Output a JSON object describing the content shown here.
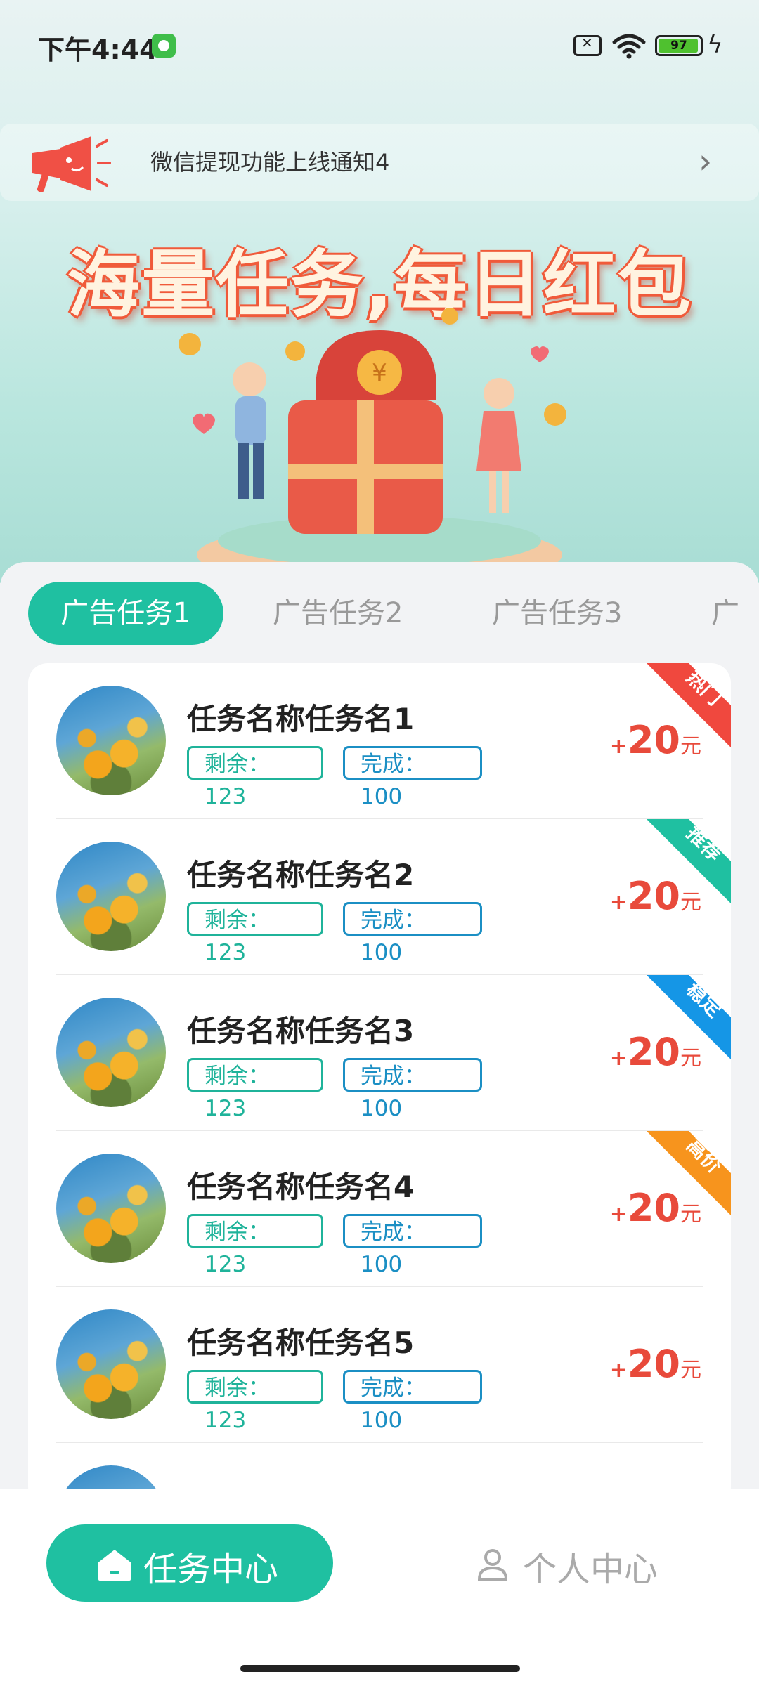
{
  "status_bar": {
    "time": "下午4:44",
    "battery": "97",
    "battery_level": 0.97
  },
  "notice": {
    "text": "微信提现功能上线通知4"
  },
  "banner": {
    "title": "海量任务,每日红包"
  },
  "tabs": [
    {
      "label": "广告任务1"
    },
    {
      "label": "广告任务2"
    },
    {
      "label": "广告任务3"
    },
    {
      "label": "广"
    }
  ],
  "tasks": [
    {
      "name": "任务名称任务名1",
      "remain": "剩余：123",
      "done": "完成：100",
      "reward_prefix": "+",
      "reward": "20",
      "reward_unit": "元",
      "badge": "热门",
      "badge_color": "#f0483e"
    },
    {
      "name": "任务名称任务名2",
      "remain": "剩余：123",
      "done": "完成：100",
      "reward_prefix": "+",
      "reward": "20",
      "reward_unit": "元",
      "badge": "推荐",
      "badge_color": "#1fc0a1"
    },
    {
      "name": "任务名称任务名3",
      "remain": "剩余：123",
      "done": "完成：100",
      "reward_prefix": "+",
      "reward": "20",
      "reward_unit": "元",
      "badge": "稳定",
      "badge_color": "#1596e6"
    },
    {
      "name": "任务名称任务名4",
      "remain": "剩余：123",
      "done": "完成：100",
      "reward_prefix": "+",
      "reward": "20",
      "reward_unit": "元",
      "badge": "高价",
      "badge_color": "#f7941d"
    },
    {
      "name": "任务名称任务名5",
      "remain": "剩余：123",
      "done": "完成：100",
      "reward_prefix": "+",
      "reward": "20",
      "reward_unit": "元",
      "badge": "",
      "badge_color": ""
    }
  ],
  "bottom_nav": {
    "task_center": "任务中心",
    "personal_center": "个人中心"
  },
  "colors": {
    "accent": "#1fc0a1",
    "reward": "#e84a3b"
  }
}
